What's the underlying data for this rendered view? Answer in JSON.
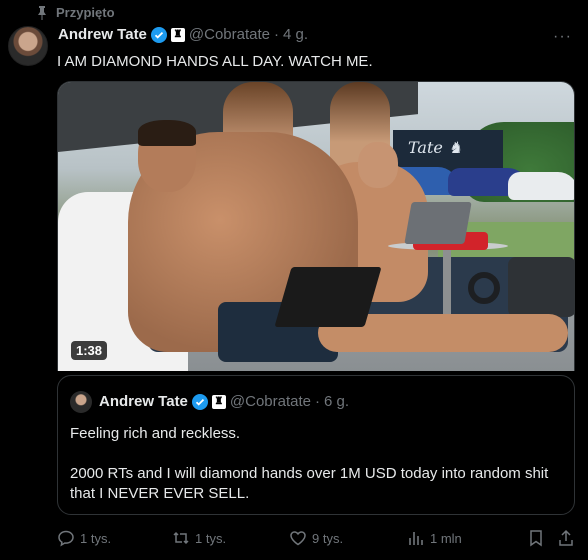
{
  "pinned": {
    "label": "Przypięto"
  },
  "tweet": {
    "author_name": "Andrew Tate",
    "affiliate_badge": "♜",
    "handle": "@Cobratate",
    "separator": "·",
    "time": "4 g.",
    "more": "···",
    "text": "I AM DIAMOND HANDS ALL DAY. WATCH ME.",
    "media": {
      "duration": "1:38",
      "background_logo_text": "Tate ♞"
    }
  },
  "quote": {
    "author_name": "Andrew Tate",
    "affiliate_badge": "♜",
    "handle": "@Cobratate",
    "separator": "·",
    "time": "6 g.",
    "lines": [
      "Feeling rich and reckless.",
      "",
      "2000 RTs and I will diamond hands over 1M USD today into random shit that I NEVER EVER SELL."
    ]
  },
  "actions": {
    "replies": "1 tys.",
    "retweets": "1 tys.",
    "likes": "9 tys.",
    "views": "1 mln"
  },
  "colors": {
    "background": "#000000",
    "text": "#e7e9ea",
    "muted": "#71767b",
    "verified": "#1d9bf0",
    "border": "#2f3336"
  }
}
